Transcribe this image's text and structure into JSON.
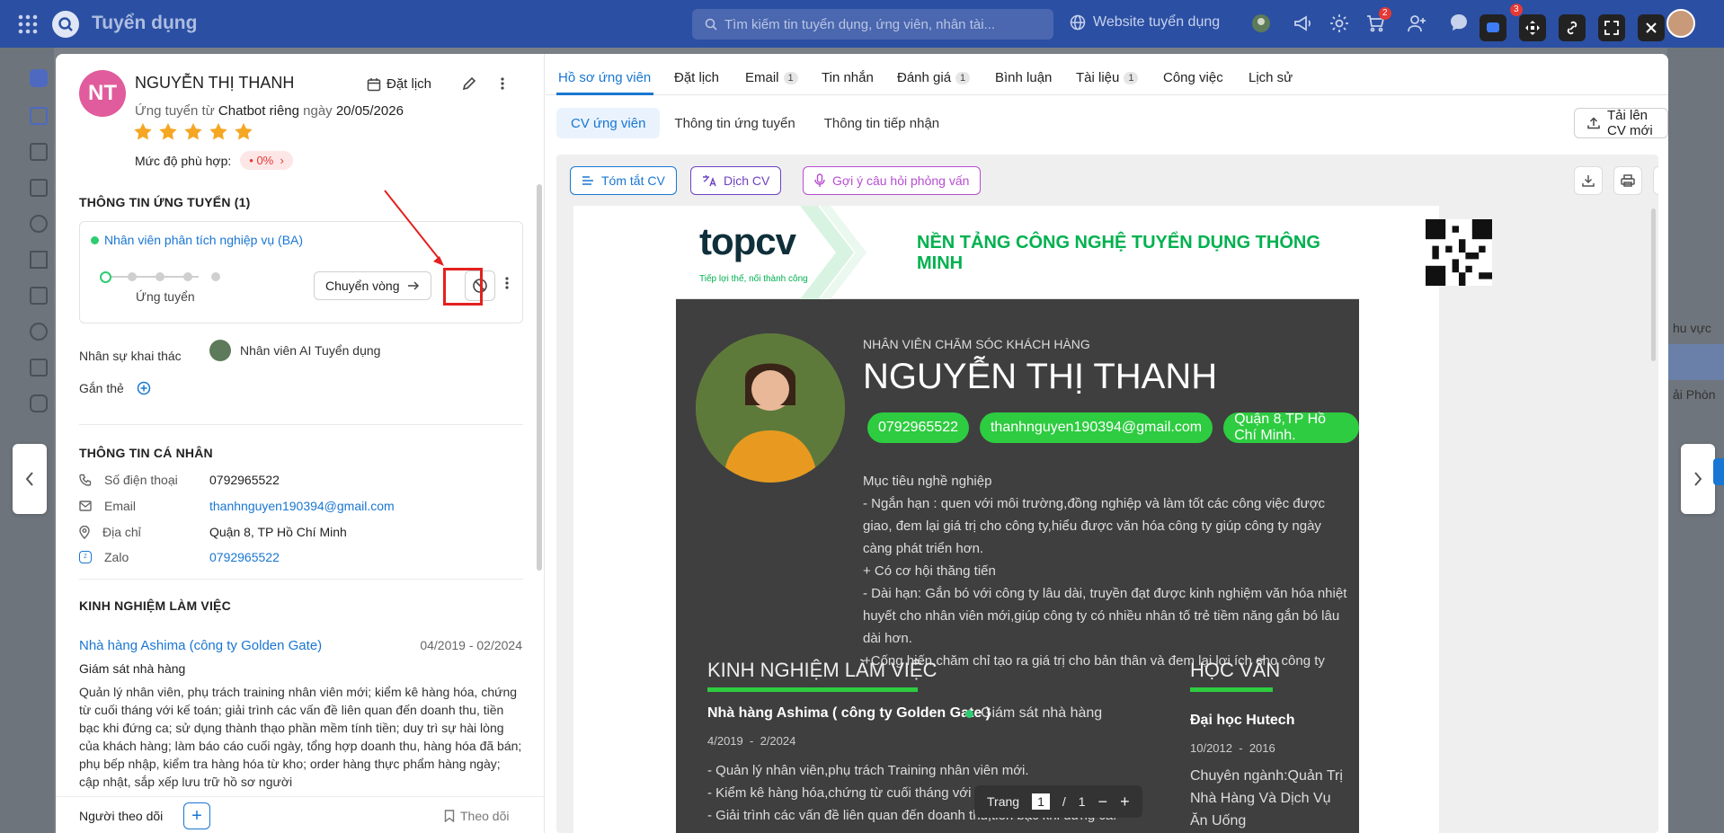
{
  "topbar": {
    "app_title": "Tuyển dụng",
    "search_placeholder": "Tìm kiếm tin tuyển dụng, ứng viên, nhân tài...",
    "website_label": "Website tuyển dụng",
    "cart_badge": "2",
    "tool_badge": "3"
  },
  "candidate": {
    "initials": "NT",
    "name": "NGUYỄN THỊ THANH",
    "schedule_label": "Đặt lịch",
    "applied_prefix": "Ứng tuyển từ",
    "applied_source": "Chatbot riêng",
    "applied_mid": "ngày",
    "applied_date": "20/05/2026",
    "rating": 5,
    "match_label": "Mức độ phù hợp:",
    "match_value": "0%"
  },
  "application": {
    "section_title": "THÔNG TIN ỨNG TUYỂN (1)",
    "job_title": "Nhân viên phân tích nghiệp vụ (BA)",
    "stage_label": "Ứng tuyển",
    "move_round_label": "Chuyển vòng",
    "recruiter_label": "Nhân sự khai thác",
    "recruiter_name": "Nhân viên AI Tuyển dụng",
    "tag_label": "Gắn thẻ"
  },
  "personal": {
    "section_title": "THÔNG TIN CÁ NHÂN",
    "phone_label": "Số điện thoại",
    "phone": "0792965522",
    "email_label": "Email",
    "email": "thanhnguyen190394@gmail.com",
    "address_label": "Địa chỉ",
    "address": "Quận 8, TP Hồ Chí Minh",
    "zalo_label": "Zalo",
    "zalo": "0792965522"
  },
  "experience": {
    "section_title": "KINH NGHIỆM LÀM VIỆC",
    "company": "Nhà hàng Ashima (công ty Golden Gate)",
    "start": "04/2019",
    "end": "02/2024",
    "role": "Giám sát nhà hàng",
    "desc": "Quản lý nhân viên, phụ trách training nhân viên mới; kiểm kê hàng hóa, chứng từ cuối tháng với kế toán; giải trình các vấn đề liên quan đến doanh thu, tiền bạc khi đứng ca; sử dụng thành thạo phần mềm tính tiền; duy trì sự hài lòng của khách hàng; làm báo cáo cuối ngày, tổng hợp doanh thu, hàng hóa đã bán; phụ bếp nhập, kiểm tra hàng hóa từ kho; order hàng thực phẩm hàng ngày; cập nhật, sắp xếp lưu trữ hồ sơ người"
  },
  "footer": {
    "followers_label": "Người theo dõi",
    "follow_label": "Theo dõi"
  },
  "tabs": [
    {
      "label": "Hồ sơ ứng viên",
      "count": ""
    },
    {
      "label": "Đặt lịch",
      "count": ""
    },
    {
      "label": "Email",
      "count": "1"
    },
    {
      "label": "Tin nhắn",
      "count": ""
    },
    {
      "label": "Đánh giá",
      "count": "1"
    },
    {
      "label": "Bình luận",
      "count": ""
    },
    {
      "label": "Tài liệu",
      "count": "1"
    },
    {
      "label": "Công việc",
      "count": ""
    },
    {
      "label": "Lịch sử",
      "count": ""
    }
  ],
  "subtabs": [
    "CV ứng viên",
    "Thông tin ứng tuyển",
    "Thông tin tiếp nhận"
  ],
  "upload_label": "Tải lên CV mới",
  "viewer": {
    "summary_label": "Tóm tắt CV",
    "translate_label": "Dịch CV",
    "questions_label": "Gợi ý câu hỏi phỏng vấn",
    "page_label": "Trang",
    "page_current": "1",
    "page_sep": "/",
    "page_total": "1"
  },
  "cv": {
    "logo_top": "top",
    "logo_cv": "cv",
    "tagline": "Tiếp lợi thế, nối thành công",
    "slogan": "NỀN TẢNG CÔNG NGHỆ TUYỂN DỤNG THÔNG MINH",
    "job": "NHÂN VIÊN CHĂM SÓC KHÁCH HÀNG",
    "name": "NGUYỄN THỊ THANH",
    "phone": "0792965522",
    "email": "thanhnguyen190394@gmail.com",
    "address": "Quận 8,TP Hồ Chí Minh.",
    "objective_title": "Mục tiêu nghề nghiệp",
    "objective_1": "- Ngắn hạn : quen với môi trường,đồng nghiệp và làm tốt các công việc được giao, đem lại giá trị cho công ty,hiểu được văn hóa công ty giúp công ty ngày càng phát triển hơn.",
    "objective_2": "+ Có cơ hội thăng tiến",
    "objective_3": "- Dài hạn: Gắn bó với công ty lâu dài, truyền đạt được kinh nghiệm văn hóa nhiệt huyết cho nhân viên mới,giúp công ty có nhiều nhân tố trẻ tiềm năng gắn bó lâu dài hơn.",
    "objective_4": "+Cống hiến,chăm chỉ tạo ra giá trị cho bản thân và đem lại lợi ích cho công ty",
    "exp_title": "KINH NGHIỆM LÀM VIỆC",
    "exp_company": "Nhà hàng Ashima ( công ty Golden Gate )",
    "exp_role": "Giám sát nhà hàng",
    "exp_start": "4/2019",
    "exp_sep": "-",
    "exp_end": "2/2024",
    "exp_line1": "- Quản lý nhân viên,phụ trách Training nhân viên mới.",
    "exp_line2": "- Kiểm kê hàng hóa,chứng từ cuối tháng với kế toán.",
    "exp_line3": "- Giải trình các vấn đề liên quan đến doanh thu,tiền bạc khi đứng ca.",
    "edu_title": "HỌC VẤN",
    "edu_school": "Đại học Hutech",
    "edu_start": "10/2012",
    "edu_sep": "-",
    "edu_end": "2016",
    "edu_major": "Chuyên ngành:Quản Trị Nhà Hàng Và Dịch Vụ Ăn Uống"
  },
  "background": {
    "col_header": "hu vực",
    "row_text": "ải Phòn"
  },
  "colors": {
    "primary": "#1976d2",
    "topbar": "#2b4fa3",
    "green": "#00b14f",
    "highlight": "#e3211f",
    "star": "#f5a623"
  }
}
